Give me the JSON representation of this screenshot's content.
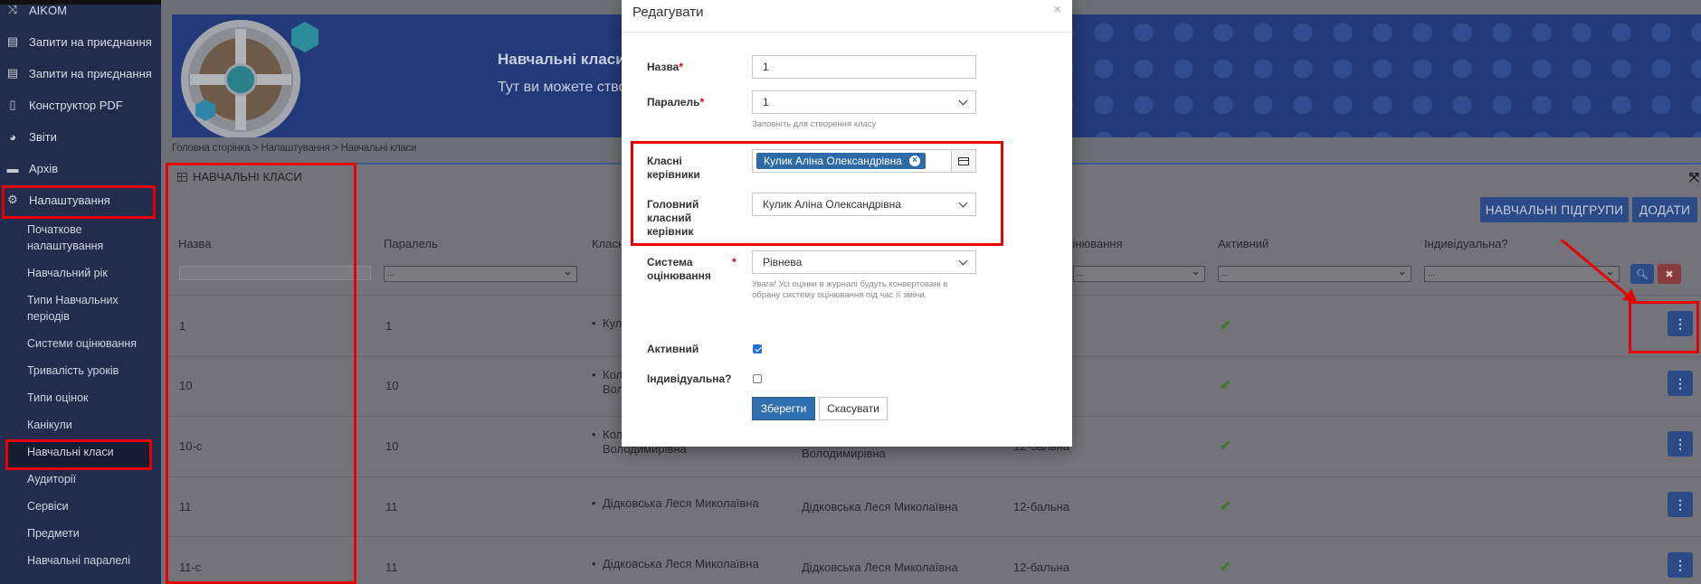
{
  "sidebar": {
    "items": [
      {
        "label": "AIKOM",
        "icon": "shuffle-icon"
      },
      {
        "label": "Запити на приєднання",
        "icon": "id-card-icon"
      },
      {
        "label": "Запити на приєднання",
        "icon": "id-card-icon"
      },
      {
        "label": "Конструктор PDF",
        "icon": "pdf-icon"
      },
      {
        "label": "Звіти",
        "icon": "pie-chart-icon"
      },
      {
        "label": "Архів",
        "icon": "archive-icon"
      },
      {
        "label": "Налаштування",
        "icon": "gears-icon"
      }
    ],
    "subitems": [
      "Початкове налаштування",
      "Навчальний рік",
      "Типи Навчальних періодів",
      "Системи оцінювання",
      "Тривалість уроків",
      "Типи оцінок",
      "Канікули",
      "Навчальні класи",
      "Аудиторії",
      "Сервіси",
      "Предмети",
      "Навчальні паралелі"
    ]
  },
  "banner": {
    "title": "Навчальні класи",
    "description": "Тут ви можете створювати навчальні класи та"
  },
  "breadcrumb": "Головна сторінка > Налаштування > Навчальні класи",
  "panel": {
    "title": "НАВЧАЛЬНІ КЛАСИ",
    "btn_subgroups": "НАВЧАЛЬНІ ПІДГРУПИ",
    "btn_add": "ДОДАТИ",
    "columns": [
      "Назва",
      "Паралель",
      "Класн",
      "цінювання",
      "Активний",
      "Індивідуальна?"
    ],
    "filter_placeholder": "...",
    "rows": [
      {
        "name": "1",
        "parallel": "1",
        "teacher": "Кул",
        "teacher2": "",
        "head": "",
        "head2": "",
        "system": ""
      },
      {
        "name": "10",
        "parallel": "10",
        "teacher": "Кол",
        "teacher2": "Вол",
        "head": "",
        "head2": "",
        "system": ""
      },
      {
        "name": "10-с",
        "parallel": "10",
        "teacher": "Кол",
        "teacher2": "Володимирівна",
        "head": "Володимирівна",
        "head2": "",
        "system": "12-бальна"
      },
      {
        "name": "11",
        "parallel": "11",
        "teacher": "Дідковська Леся Миколаївна",
        "teacher2": "",
        "head": "Дідковська Леся Миколаївна",
        "head2": "",
        "system": "12-бальна"
      },
      {
        "name": "11-с",
        "parallel": "11",
        "teacher": "Дідковська Леся Миколаївна",
        "teacher2": "",
        "head": "Дідковська Леся Миколаївна",
        "head2": "",
        "system": "12-бальна"
      }
    ]
  },
  "modal": {
    "title": "Редагувати",
    "name_label": "Назва",
    "name_value": "1",
    "parallel_label": "Паралель",
    "parallel_value": "1",
    "parallel_hint": "Заповніть для створення класу",
    "teachers_label_1": "Класні",
    "teachers_label_2": "керівники",
    "teacher_tag": "Кулик Аліна Олександрівна",
    "head_label_1": "Головний",
    "head_label_2": "класний",
    "head_label_3": "керівник",
    "head_value": "Кулик Аліна Олександрівна",
    "system_label_1": "Система",
    "system_label_2": "оцінювання",
    "system_value": "Рівнева",
    "system_hint_1": "Увага! Усі оцінки в журналі будуть конвертовані в",
    "system_hint_2": "обрану систему оцінювання під час її зміни.",
    "active_label": "Активний",
    "active": true,
    "individual_label": "Індивідуальна?",
    "individual": false,
    "save": "Зберегти",
    "cancel": "Скасувати",
    "required_mark": "*"
  },
  "colors": {
    "accent": "#2f6fb0",
    "highlight": "#e60000",
    "sidebar": "#232c4d"
  }
}
